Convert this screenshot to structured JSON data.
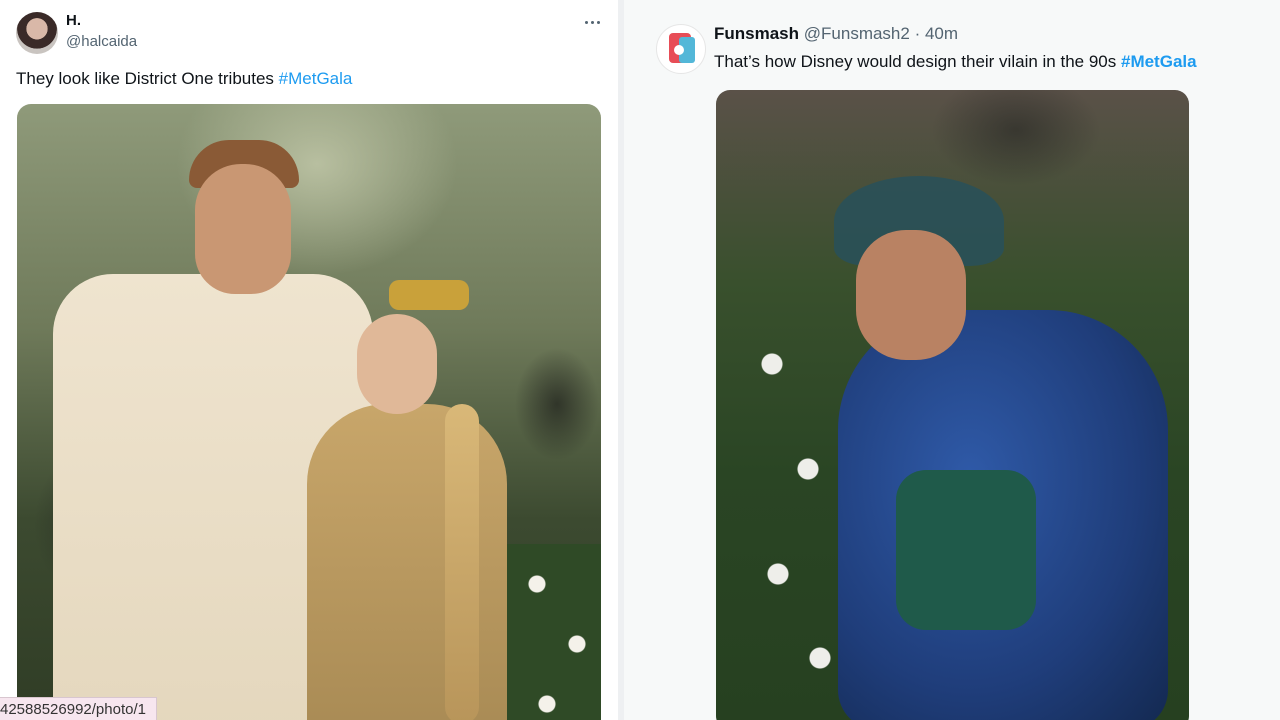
{
  "tweets": [
    {
      "name": "H.",
      "handle": "@halcaida",
      "text": "They look like District One tributes",
      "hashtag": "#MetGala",
      "media_icon": "photo-icon"
    },
    {
      "name": "Funsmash",
      "handle": "@Funsmash2",
      "time": "· 40m",
      "text": "That’s how Disney would design their vilain in the 90s",
      "hashtag": "#MetGala",
      "media_icon": "photo-icon"
    }
  ],
  "status_bar": {
    "url": "42588526992/photo/1"
  },
  "hash_fragment": "#",
  "colors": {
    "hashtag": "#1d9bf0",
    "handle": "#536471",
    "text": "#0f1419",
    "right_panel_bg": "#f7f9f9"
  },
  "icons": {
    "more": "more-horizontal-icon"
  }
}
